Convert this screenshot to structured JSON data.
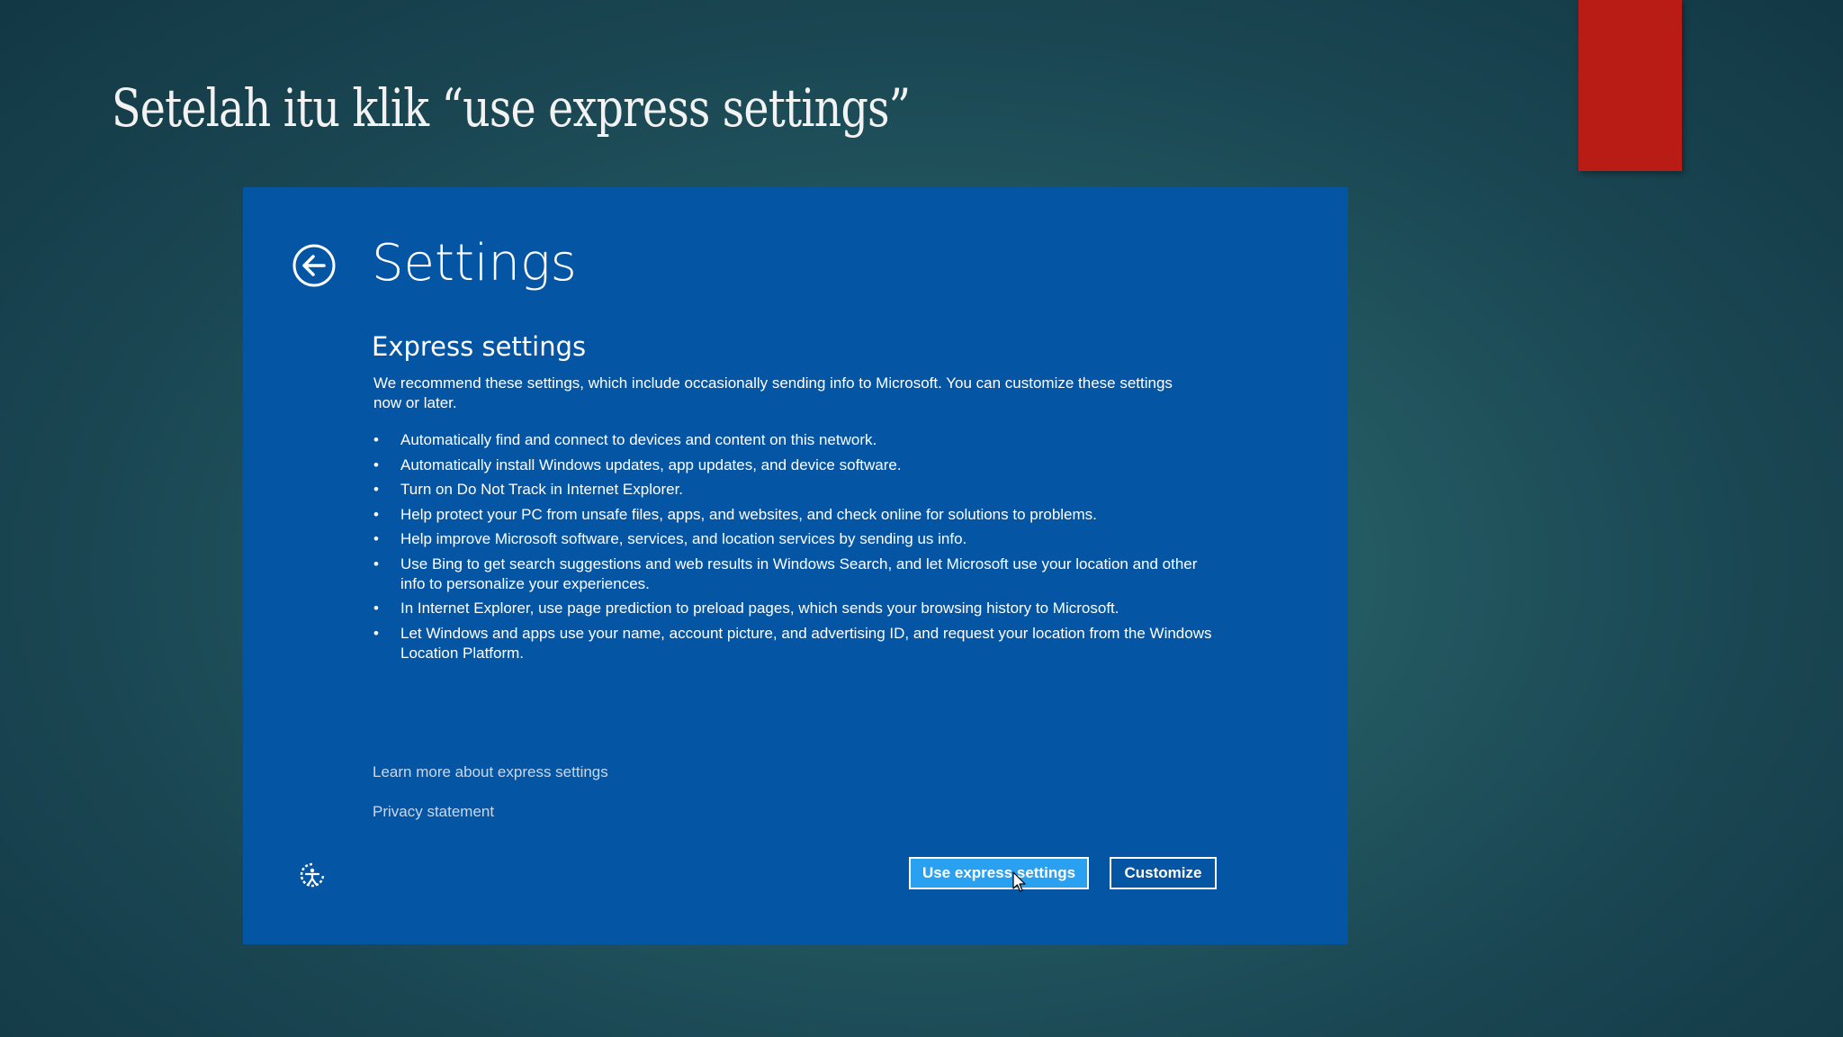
{
  "slide": {
    "title": "Setelah itu klik “use express settings”"
  },
  "settings_window": {
    "title": "Settings",
    "section_heading": "Express settings",
    "intro": "We recommend these settings, which include occasionally sending info to Microsoft. You can customize these settings now or later.",
    "items": [
      "Automatically find and connect to devices and content on this network.",
      "Automatically install Windows updates, app updates, and device software.",
      "Turn on Do Not Track in Internet Explorer.",
      "Help protect your PC from unsafe files, apps, and websites, and check online for solutions to problems.",
      "Help improve Microsoft software, services, and location services by sending us info.",
      "Use Bing to get search suggestions and web results in Windows Search, and let Microsoft use your location and other info to personalize your experiences.",
      "In Internet Explorer, use page prediction to preload pages, which sends your browsing history to Microsoft.",
      "Let Windows and apps use your name, account picture, and advertising ID, and request your location from the Windows Location Platform."
    ],
    "links": {
      "learn_more": "Learn more about express settings",
      "privacy": "Privacy statement"
    },
    "buttons": {
      "express": "Use express settings",
      "customize": "Customize"
    }
  },
  "icons": {
    "back": "back-arrow-circle-icon",
    "ease_of_access": "ease-of-access-icon",
    "cursor": "mouse-pointer-icon"
  },
  "colors": {
    "panel": "#0455a3",
    "primary_button": "#2aa0f0",
    "accent_red": "#b81c15"
  }
}
